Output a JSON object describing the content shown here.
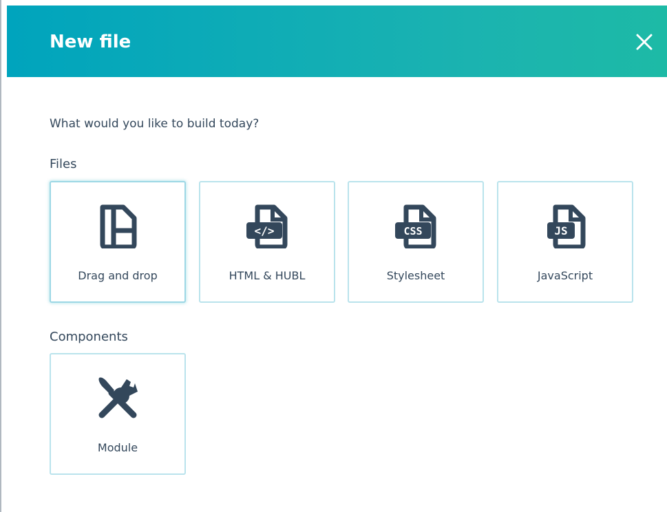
{
  "dialog": {
    "title": "New file",
    "close_icon": "close-icon",
    "prompt": "What would you like to build today?"
  },
  "files": {
    "label": "Files",
    "items": [
      {
        "label": "Drag and drop",
        "icon": "drag-and-drop-layout-icon",
        "selected": true
      },
      {
        "label": "HTML & HUBL",
        "icon": "html-file-icon",
        "badge": "</>"
      },
      {
        "label": "Stylesheet",
        "icon": "css-file-icon",
        "badge": "CSS"
      },
      {
        "label": "JavaScript",
        "icon": "js-file-icon",
        "badge": "JS"
      }
    ]
  },
  "components": {
    "label": "Components",
    "items": [
      {
        "label": "Module",
        "icon": "brush-and-wrench-icon"
      }
    ]
  },
  "colors": {
    "header_gradient_start": "#00a4bd",
    "header_gradient_end": "#1dbaa6",
    "card_border": "#b9e3ec",
    "text": "#33475b",
    "icon": "#33475b"
  }
}
